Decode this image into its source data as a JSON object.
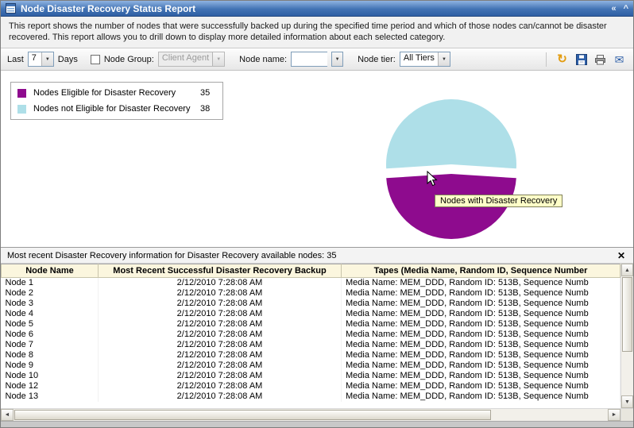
{
  "titlebar": {
    "title": "Node Disaster Recovery Status Report"
  },
  "icons": {
    "collapse": "«",
    "shade": "^",
    "dropdown_arrow": "▼",
    "close": "✕",
    "refresh": "↻",
    "email": "✉",
    "scroll_up": "▲",
    "scroll_down": "▼",
    "scroll_left": "◄",
    "scroll_right": "►"
  },
  "description": "This report shows the number of nodes that were successfully backed up during the specified time period and which of those nodes can/cannot be disaster recovered. This report allows you to drill down to display more detailed information about each selected category.",
  "filters": {
    "last_label": "Last",
    "last_value": "7",
    "days_label": "Days",
    "node_group_label": "Node Group:",
    "node_group_value": "Client Agent",
    "node_name_label": "Node name:",
    "node_name_value": "",
    "node_tier_label": "Node tier:",
    "node_tier_value": "All Tiers"
  },
  "chart_data": {
    "type": "pie",
    "title": "",
    "legend_position": "top-left",
    "slices": [
      {
        "label": "Nodes Eligible for Disaster Recovery",
        "value": 35,
        "color": "#8E0B8E"
      },
      {
        "label": "Nodes not Eligible for Disaster Recovery",
        "value": 38,
        "color": "#AEDFE8"
      }
    ],
    "exploded_slice": "Nodes not Eligible for Disaster Recovery",
    "tooltip": "Nodes with Disaster Recovery"
  },
  "detail_panel": {
    "header": "Most recent Disaster Recovery information for Disaster Recovery available nodes: 35",
    "columns": [
      "Node Name",
      "Most Recent Successful Disaster Recovery Backup",
      "Tapes (Media Name, Random ID, Sequence Number"
    ],
    "rows": [
      {
        "node": "Node 1",
        "backup": "2/12/2010 7:28:08 AM",
        "tapes": "Media Name: MEM_DDD, Random ID: 513B, Sequence Numb"
      },
      {
        "node": "Node 2",
        "backup": "2/12/2010 7:28:08 AM",
        "tapes": "Media Name: MEM_DDD, Random ID: 513B, Sequence Numb"
      },
      {
        "node": "Node 3",
        "backup": "2/12/2010 7:28:08 AM",
        "tapes": "Media Name: MEM_DDD, Random ID: 513B, Sequence Numb"
      },
      {
        "node": "Node 4",
        "backup": "2/12/2010 7:28:08 AM",
        "tapes": "Media Name: MEM_DDD, Random ID: 513B, Sequence Numb"
      },
      {
        "node": "Node 5",
        "backup": "2/12/2010 7:28:08 AM",
        "tapes": "Media Name: MEM_DDD, Random ID: 513B, Sequence Numb"
      },
      {
        "node": "Node 6",
        "backup": "2/12/2010 7:28:08 AM",
        "tapes": "Media Name: MEM_DDD, Random ID: 513B, Sequence Numb"
      },
      {
        "node": "Node 7",
        "backup": "2/12/2010 7:28:08 AM",
        "tapes": "Media Name: MEM_DDD, Random ID: 513B, Sequence Numb"
      },
      {
        "node": "Node 8",
        "backup": "2/12/2010 7:28:08 AM",
        "tapes": "Media Name: MEM_DDD, Random ID: 513B, Sequence Numb"
      },
      {
        "node": "Node 9",
        "backup": "2/12/2010 7:28:08 AM",
        "tapes": "Media Name: MEM_DDD, Random ID: 513B, Sequence Numb"
      },
      {
        "node": "Node 10",
        "backup": "2/12/2010 7:28:08 AM",
        "tapes": "Media Name: MEM_DDD, Random ID: 513B, Sequence Numb"
      },
      {
        "node": "Node 12",
        "backup": "2/12/2010 7:28:08 AM",
        "tapes": "Media Name: MEM_DDD, Random ID: 513B, Sequence Numb"
      },
      {
        "node": "Node 13",
        "backup": "2/12/2010 7:28:08 AM",
        "tapes": "Media Name: MEM_DDD, Random ID: 513B, Sequence Numb"
      }
    ]
  }
}
